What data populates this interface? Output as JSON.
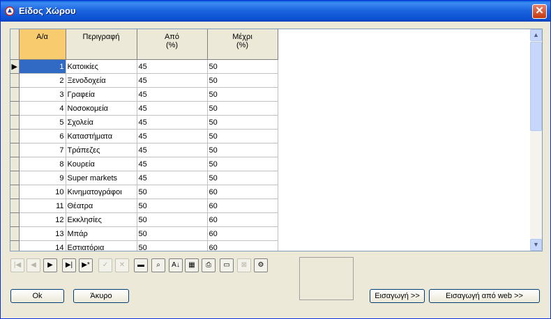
{
  "window": {
    "title": "Είδος Χώρου",
    "close_glyph": "✕"
  },
  "grid": {
    "columns": [
      {
        "label": "Α/α"
      },
      {
        "label": "Περιγραφή"
      },
      {
        "label": "Από\n(%)"
      },
      {
        "label": "Μέχρι\n(%)"
      }
    ],
    "current_row_glyph": "▶",
    "rows": [
      {
        "num": "1",
        "desc": "Κατοικίες",
        "from": "45",
        "to": "50"
      },
      {
        "num": "2",
        "desc": "Ξενοδοχεία",
        "from": "45",
        "to": "50"
      },
      {
        "num": "3",
        "desc": "Γραφεία",
        "from": "45",
        "to": "50"
      },
      {
        "num": "4",
        "desc": "Νοσοκομεία",
        "from": "45",
        "to": "50"
      },
      {
        "num": "5",
        "desc": "Σχολεία",
        "from": "45",
        "to": "50"
      },
      {
        "num": "6",
        "desc": "Καταστήματα",
        "from": "45",
        "to": "50"
      },
      {
        "num": "7",
        "desc": "Τράπεζες",
        "from": "45",
        "to": "50"
      },
      {
        "num": "8",
        "desc": "Κουρεία",
        "from": "45",
        "to": "50"
      },
      {
        "num": "9",
        "desc": "Super markets",
        "from": "45",
        "to": "50"
      },
      {
        "num": "10",
        "desc": "Κινηματογράφοι",
        "from": "50",
        "to": "60"
      },
      {
        "num": "11",
        "desc": "Θέατρα",
        "from": "50",
        "to": "60"
      },
      {
        "num": "12",
        "desc": "Εκκλησίες",
        "from": "50",
        "to": "60"
      },
      {
        "num": "13",
        "desc": "Μπάρ",
        "from": "50",
        "to": "60"
      },
      {
        "num": "14",
        "desc": "Εστιατόρια",
        "from": "50",
        "to": "60"
      }
    ]
  },
  "scrollbar": {
    "up_glyph": "▲",
    "down_glyph": "▼"
  },
  "toolbar": {
    "buttons": [
      {
        "name": "first-record-button",
        "glyph": "|◀",
        "enabled": false
      },
      {
        "name": "prior-record-button",
        "glyph": "◀",
        "enabled": false
      },
      {
        "name": "next-record-button",
        "glyph": "▶",
        "enabled": true
      },
      {
        "name": "last-record-button",
        "glyph": "▶|",
        "enabled": true
      },
      {
        "name": "new-record-button",
        "glyph": "▶*",
        "enabled": true
      },
      {
        "name": "post-button",
        "glyph": "✓",
        "enabled": false
      },
      {
        "name": "cancel-edit-button",
        "glyph": "✕",
        "enabled": false
      },
      {
        "name": "delete-record-button",
        "glyph": "▬",
        "enabled": true
      },
      {
        "name": "find-button",
        "glyph": "⌕",
        "enabled": true
      },
      {
        "name": "sort-button",
        "glyph": "A↓",
        "enabled": true
      },
      {
        "name": "table-button",
        "glyph": "▦",
        "enabled": true
      },
      {
        "name": "print-button",
        "glyph": "⎙",
        "enabled": true
      },
      {
        "name": "picture-button",
        "glyph": "▭",
        "enabled": true
      },
      {
        "name": "remove-picture-button",
        "glyph": "⊠",
        "enabled": false
      },
      {
        "name": "tool-button",
        "glyph": "⚙",
        "enabled": true
      }
    ]
  },
  "buttons": {
    "ok": "Ok",
    "cancel": "Άκυρο",
    "import": "Εισαγωγή >>",
    "import_web": "Εισαγωγή από web >>"
  }
}
